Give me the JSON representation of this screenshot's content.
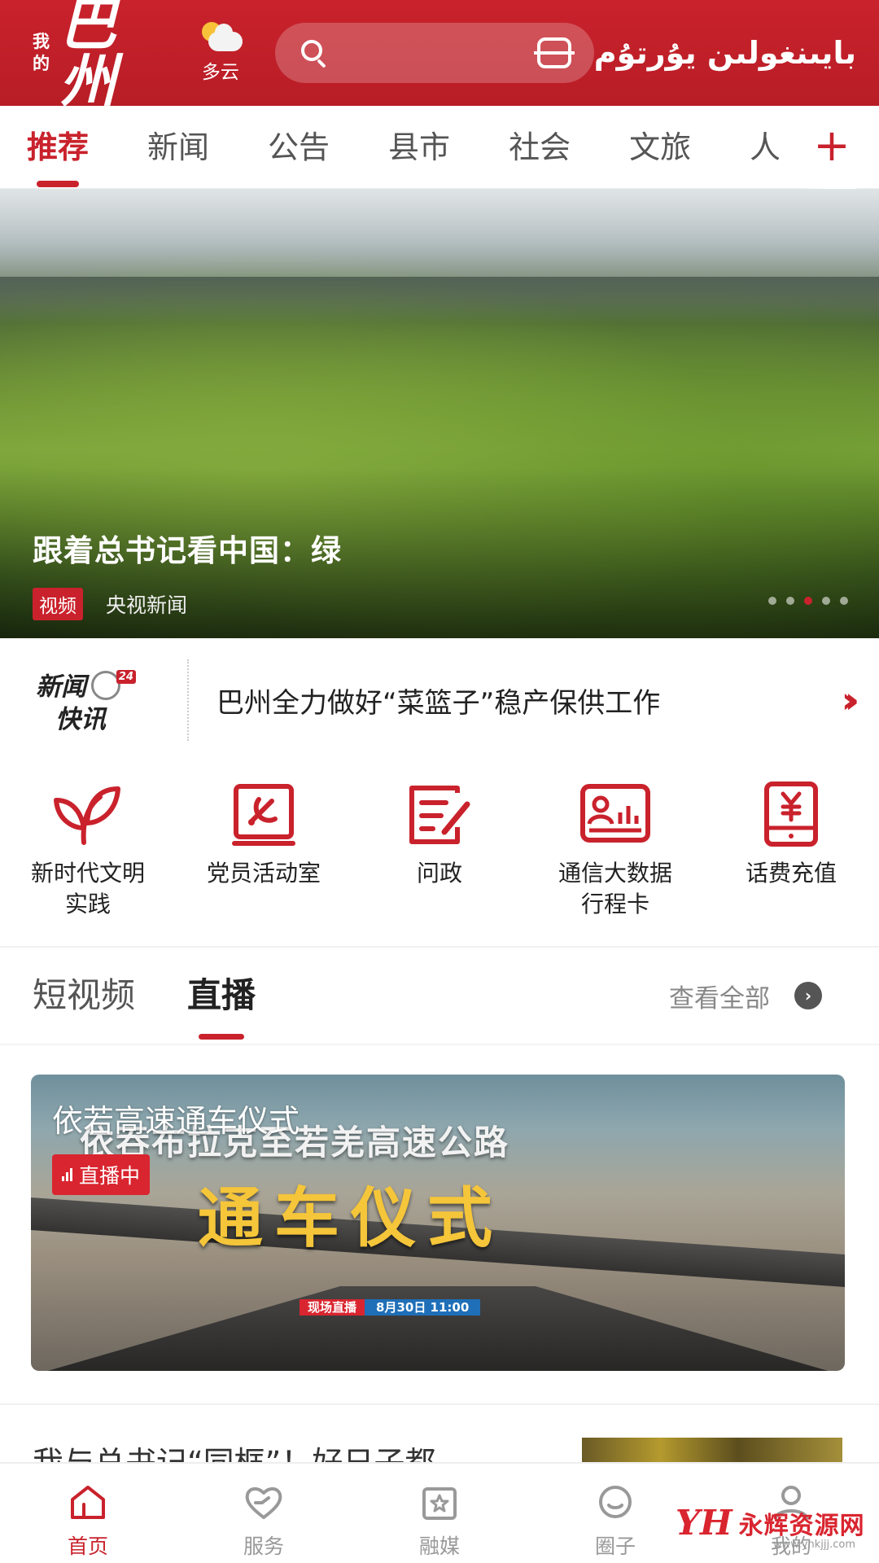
{
  "header": {
    "logo_small_1": "我",
    "logo_small_2": "的",
    "logo_main": "巴州",
    "weather_label": "多云",
    "uyghur_text": "بايىنغولىن يۇرتۇم",
    "accent_color": "#c9222c"
  },
  "tabs": [
    {
      "label": "推荐",
      "active": true
    },
    {
      "label": "新闻"
    },
    {
      "label": "公告"
    },
    {
      "label": "县市"
    },
    {
      "label": "社会"
    },
    {
      "label": "文旅"
    },
    {
      "label": "人"
    }
  ],
  "tabs_more_icon": "plus-icon",
  "banner": {
    "title": "跟着总书记看中国：绿",
    "badge": "视频",
    "source": "央视新闻",
    "slide_count": 5,
    "active_slide": 3
  },
  "news_flash": {
    "logo_line1": "新闻",
    "logo_line2": "快讯",
    "headline": "巴州全力做好“菜篮子”稳产保供工作"
  },
  "services": [
    {
      "label": "新时代文明\n实践",
      "icon": "leaf-icon"
    },
    {
      "label": "党员活动室",
      "icon": "party-emblem-icon"
    },
    {
      "label": "问政",
      "icon": "edit-document-icon"
    },
    {
      "label": "通信大数据\n行程卡",
      "icon": "trip-card-icon"
    },
    {
      "label": "话费充值",
      "icon": "phone-yuan-icon"
    }
  ],
  "video_section": {
    "tabs": [
      {
        "label": "短视频"
      },
      {
        "label": "直播",
        "active": true
      }
    ],
    "see_all": "查看全部"
  },
  "live_card": {
    "title": "依若高速通车仪式",
    "badge": "直播中",
    "overlay_line1": "依吞布拉克至若羌高速公路",
    "overlay_line2": "通车仪式",
    "strip_left": "现场直播",
    "strip_right": "8月30日 11:00"
  },
  "article": {
    "text": "我与总书记“同框”！好日子都"
  },
  "bottom_nav": [
    {
      "label": "首页",
      "icon": "home-icon",
      "active": true
    },
    {
      "label": "服务",
      "icon": "heart-hand-icon"
    },
    {
      "label": "融媒",
      "icon": "media-star-icon"
    },
    {
      "label": "圈子",
      "icon": "chat-bubble-icon"
    },
    {
      "label": "我的",
      "icon": "user-icon"
    }
  ],
  "watermark": {
    "mark": "YH",
    "text": "永辉资源网",
    "url": "www.yhkjjj.com"
  }
}
